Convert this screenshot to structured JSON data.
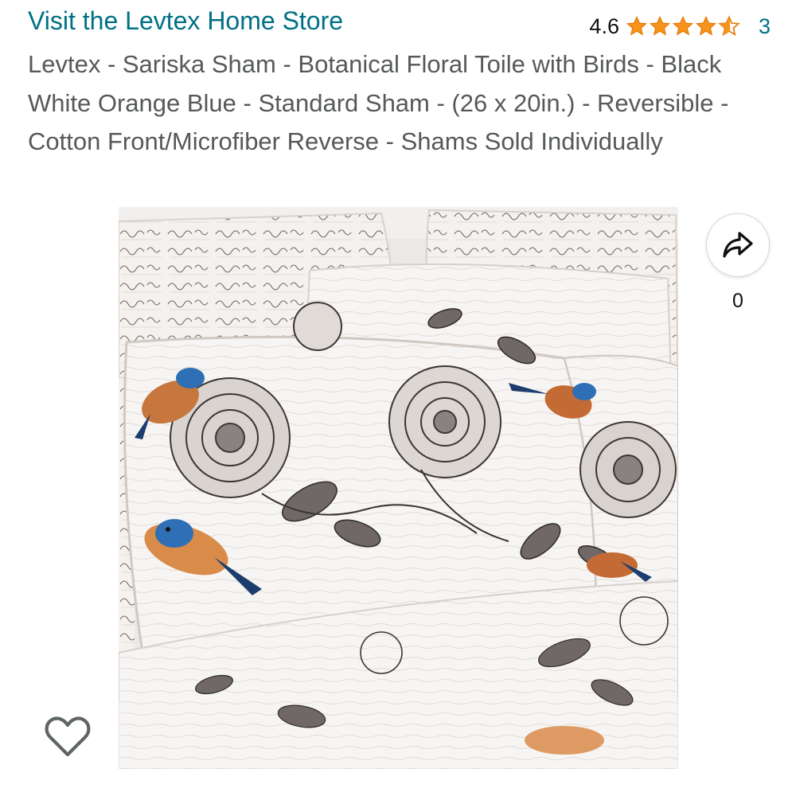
{
  "store": {
    "link_text": "Visit the Levtex Home Store"
  },
  "rating": {
    "value": "4.6",
    "stars": 4.6,
    "count": "3",
    "star_color": "#F7941D",
    "star_outline_color": "#E77600"
  },
  "product": {
    "title": "Levtex - Sariska Sham - Botanical Floral Toile with Birds - Black White Orange Blue - Standard Sham - (26 x 20in.) - Reversible - Cotton Front/Microfiber Reverse - Shams Sold Individually",
    "image_description_icon": "product-photo"
  },
  "share": {
    "icon": "share-arrow-icon",
    "count": "0"
  },
  "wishlist": {
    "icon": "heart-outline-icon"
  },
  "colors": {
    "link": "#007185",
    "title_text": "#565959",
    "body_text": "#0F1111"
  }
}
